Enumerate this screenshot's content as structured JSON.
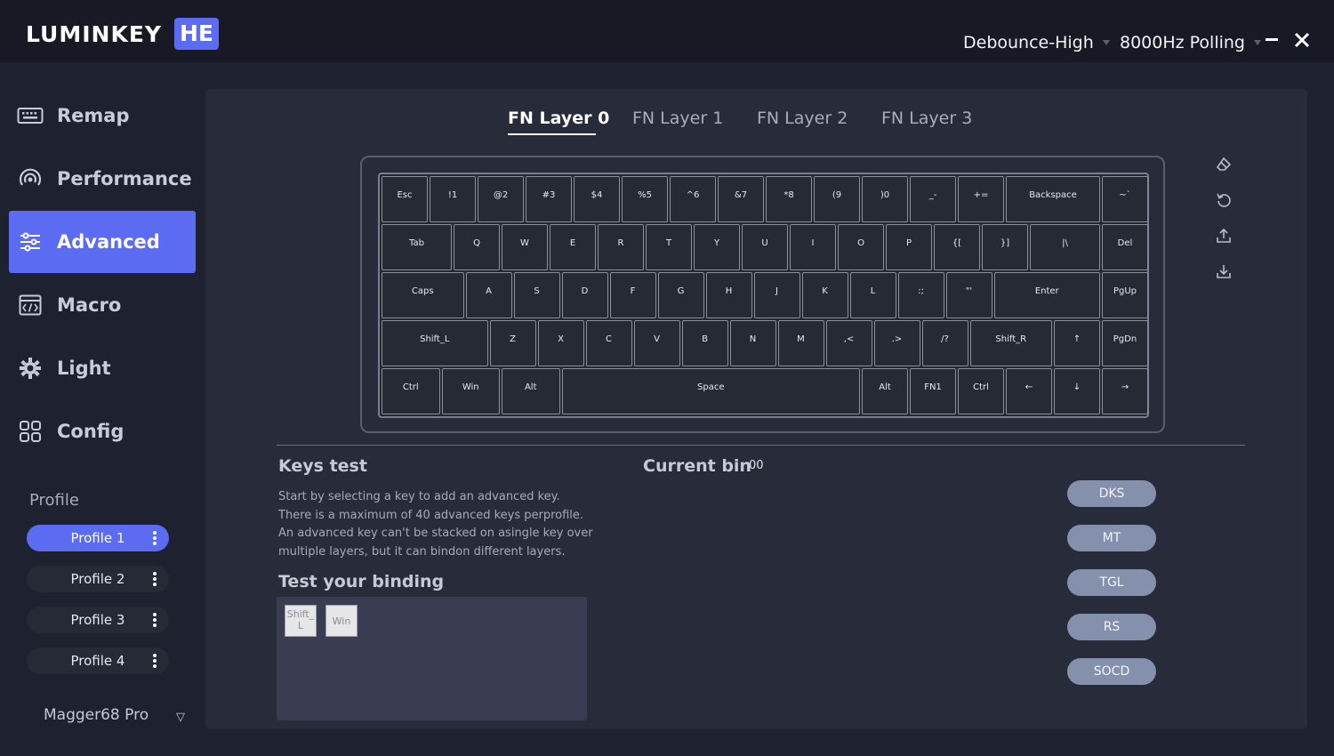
{
  "header": {
    "logo": "LUMINKEY",
    "logo_badge": "HE",
    "debounce": "Debounce-High",
    "polling": "8000Hz Polling",
    "minimize": "−",
    "close": "✕"
  },
  "sidebar": {
    "items": [
      {
        "label": "Remap",
        "icon": "keyboard-icon"
      },
      {
        "label": "Performance",
        "icon": "performance-icon"
      },
      {
        "label": "Advanced",
        "icon": "sliders-icon"
      },
      {
        "label": "Macro",
        "icon": "macro-code-icon"
      },
      {
        "label": "Light",
        "icon": "light-gear-icon"
      },
      {
        "label": "Config",
        "icon": "grid-icon"
      }
    ],
    "active_index": 2
  },
  "profiles": {
    "heading": "Profile",
    "items": [
      "Profile 1",
      "Profile 2",
      "Profile 3",
      "Profile 4"
    ],
    "active_index": 0
  },
  "device": {
    "name": "Magger68 Pro"
  },
  "tabs": [
    "FN Layer 0",
    "FN Layer 1",
    "FN Layer 2",
    "FN Layer 3"
  ],
  "keyboard": {
    "rows": [
      [
        "Esc",
        "!1",
        "@2",
        "#3",
        "$4",
        "%5",
        "^6",
        "&7",
        "*8",
        "(9",
        ")0",
        "_-",
        "+=",
        "Backspace",
        "~`"
      ],
      [
        "Tab",
        "Q",
        "W",
        "E",
        "R",
        "T",
        "Y",
        "U",
        "I",
        "O",
        "P",
        "{[",
        "}]",
        "|\\",
        "Del"
      ],
      [
        "Caps",
        "A",
        "S",
        "D",
        "F",
        "G",
        "H",
        "J",
        "K",
        "L",
        ":;",
        "\"'",
        "Enter",
        "PgUp"
      ],
      [
        "Shift_L",
        "Z",
        "X",
        "C",
        "V",
        "B",
        "N",
        "M",
        ",<",
        ".>",
        "/?",
        "Shift_R",
        "↑",
        "PgDn"
      ],
      [
        "Ctrl",
        "Win",
        "Alt",
        "Space",
        "Alt",
        "FN1",
        "Ctrl",
        "←",
        "↓",
        "→"
      ]
    ]
  },
  "tools": [
    "eraser-icon",
    "reset-icon",
    "export-icon",
    "import-icon"
  ],
  "keys_test": {
    "title": "Keys test",
    "description": [
      "Start by selecting a key to add an advanced key.",
      "There is a maximum of 40 advanced keys perprofile.",
      "An advanced key can't be stacked on asingle key over",
      "multiple layers, but it can bindon different layers."
    ]
  },
  "current_bin": {
    "label": "Current bin",
    "value": "00"
  },
  "test_binding": {
    "title": "Test your binding",
    "keys": [
      "Shift_\nL",
      "Win"
    ]
  },
  "advanced_keys": [
    "DKS",
    "MT",
    "TGL",
    "RS",
    "SOCD"
  ],
  "colors": {
    "accent": "#5b6cf3",
    "background": "#1e2230",
    "panel": "#282c3a",
    "adv_button": "#8590ad"
  }
}
